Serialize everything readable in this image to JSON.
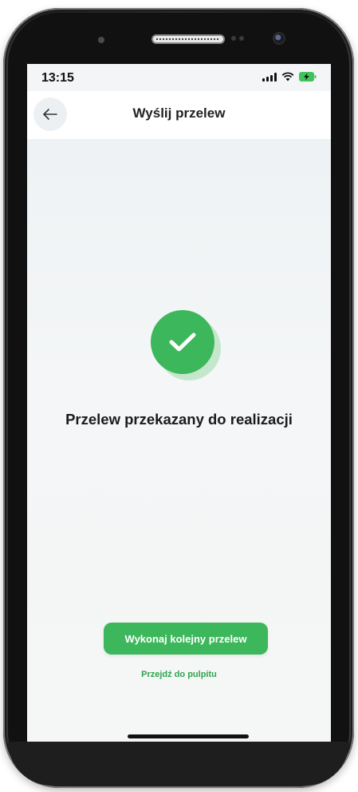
{
  "status_bar": {
    "time": "13:15",
    "icons": [
      "signal-icon",
      "wifi-icon",
      "battery-charging-icon"
    ]
  },
  "nav": {
    "back_icon": "arrow-left-icon",
    "title": "Wyślij przelew"
  },
  "result": {
    "icon": "checkmark-circle-icon",
    "message": "Przelew przekazany do realizacji"
  },
  "actions": {
    "primary_label": "Wykonaj kolejny przelew",
    "secondary_label": "Przejdź do pulpitu"
  },
  "colors": {
    "accent": "#3cb75b",
    "accent_light": "#c5e7cc",
    "link": "#2fa44e",
    "background": "#f3f5f6"
  }
}
